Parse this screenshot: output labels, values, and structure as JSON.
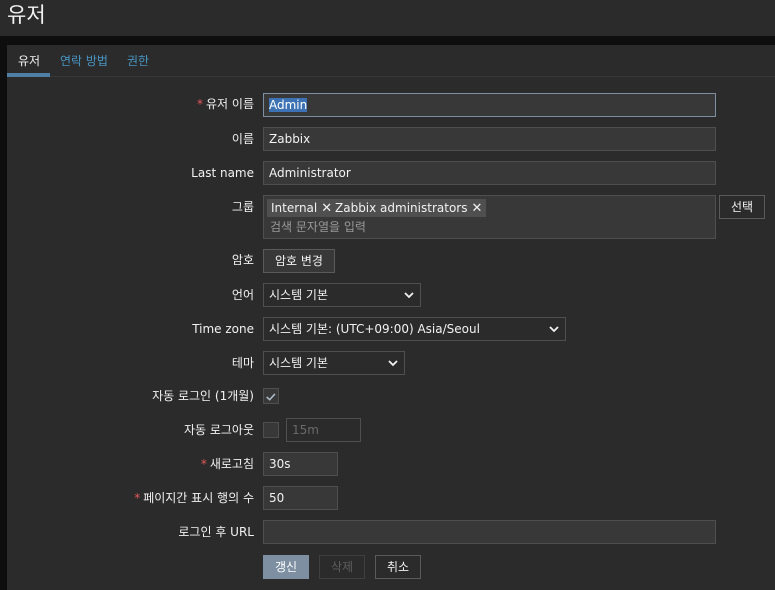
{
  "page": {
    "title": "유저"
  },
  "tabs": [
    {
      "label": "유저",
      "active": true
    },
    {
      "label": "연락 방법",
      "active": false
    },
    {
      "label": "권한",
      "active": false
    }
  ],
  "form": {
    "username": {
      "label": "유저 이름",
      "required": true,
      "value": "Admin"
    },
    "name": {
      "label": "이름",
      "value": "Zabbix"
    },
    "lastname": {
      "label": "Last name",
      "value": "Administrator"
    },
    "groups": {
      "label": "그룹",
      "chips": [
        "Internal",
        "Zabbix administrators"
      ],
      "placeholder": "검색 문자열을 입력",
      "select_button": "선택"
    },
    "password": {
      "label": "암호",
      "button": "암호 변경"
    },
    "language": {
      "label": "언어",
      "value": "시스템 기본"
    },
    "timezone": {
      "label": "Time zone",
      "value": "시스템 기본: (UTC+09:00) Asia/Seoul"
    },
    "theme": {
      "label": "테마",
      "value": "시스템 기본"
    },
    "autologin": {
      "label": "자동 로그인 (1개월)",
      "checked": true
    },
    "autologout": {
      "label": "자동 로그아웃",
      "checked": false,
      "placeholder": "15m"
    },
    "refresh": {
      "label": "새로고침",
      "required": true,
      "value": "30s"
    },
    "rows_per_page": {
      "label": "페이지간 표시 행의 수",
      "required": true,
      "value": "50"
    },
    "url_after_login": {
      "label": "로그인 후 URL",
      "value": ""
    }
  },
  "actions": {
    "update": "갱신",
    "delete": "삭제",
    "cancel": "취소"
  },
  "icons": {
    "chip_remove": "close-icon",
    "dropdown": "chevron-down-icon",
    "check": "checkmark-icon"
  },
  "colors": {
    "accent": "#4796c4",
    "required": "#e45959",
    "primary_button": "#7d8fa0"
  }
}
